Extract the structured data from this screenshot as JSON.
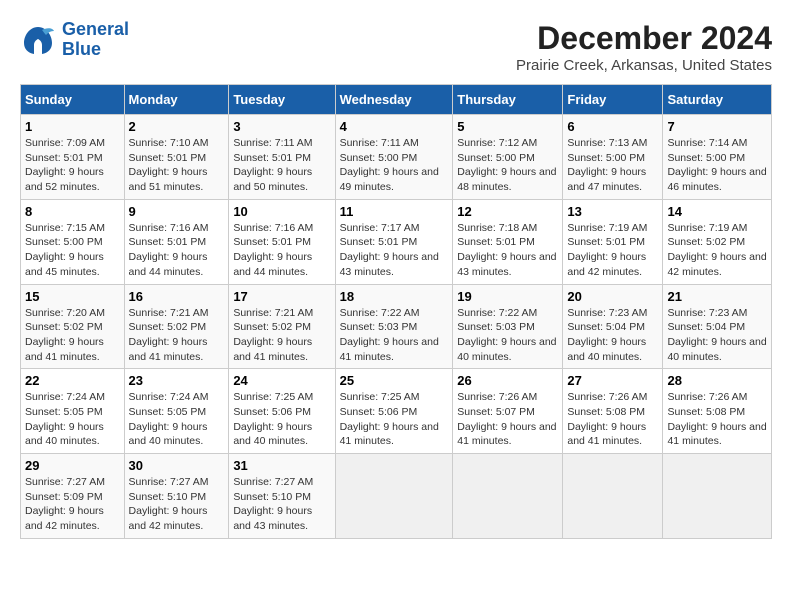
{
  "logo": {
    "line1": "General",
    "line2": "Blue"
  },
  "title": "December 2024",
  "subtitle": "Prairie Creek, Arkansas, United States",
  "days_of_week": [
    "Sunday",
    "Monday",
    "Tuesday",
    "Wednesday",
    "Thursday",
    "Friday",
    "Saturday"
  ],
  "weeks": [
    [
      {
        "day": "1",
        "sunrise": "7:09 AM",
        "sunset": "5:01 PM",
        "daylight": "9 hours and 52 minutes."
      },
      {
        "day": "2",
        "sunrise": "7:10 AM",
        "sunset": "5:01 PM",
        "daylight": "9 hours and 51 minutes."
      },
      {
        "day": "3",
        "sunrise": "7:11 AM",
        "sunset": "5:01 PM",
        "daylight": "9 hours and 50 minutes."
      },
      {
        "day": "4",
        "sunrise": "7:11 AM",
        "sunset": "5:00 PM",
        "daylight": "9 hours and 49 minutes."
      },
      {
        "day": "5",
        "sunrise": "7:12 AM",
        "sunset": "5:00 PM",
        "daylight": "9 hours and 48 minutes."
      },
      {
        "day": "6",
        "sunrise": "7:13 AM",
        "sunset": "5:00 PM",
        "daylight": "9 hours and 47 minutes."
      },
      {
        "day": "7",
        "sunrise": "7:14 AM",
        "sunset": "5:00 PM",
        "daylight": "9 hours and 46 minutes."
      }
    ],
    [
      {
        "day": "8",
        "sunrise": "7:15 AM",
        "sunset": "5:00 PM",
        "daylight": "9 hours and 45 minutes."
      },
      {
        "day": "9",
        "sunrise": "7:16 AM",
        "sunset": "5:01 PM",
        "daylight": "9 hours and 44 minutes."
      },
      {
        "day": "10",
        "sunrise": "7:16 AM",
        "sunset": "5:01 PM",
        "daylight": "9 hours and 44 minutes."
      },
      {
        "day": "11",
        "sunrise": "7:17 AM",
        "sunset": "5:01 PM",
        "daylight": "9 hours and 43 minutes."
      },
      {
        "day": "12",
        "sunrise": "7:18 AM",
        "sunset": "5:01 PM",
        "daylight": "9 hours and 43 minutes."
      },
      {
        "day": "13",
        "sunrise": "7:19 AM",
        "sunset": "5:01 PM",
        "daylight": "9 hours and 42 minutes."
      },
      {
        "day": "14",
        "sunrise": "7:19 AM",
        "sunset": "5:02 PM",
        "daylight": "9 hours and 42 minutes."
      }
    ],
    [
      {
        "day": "15",
        "sunrise": "7:20 AM",
        "sunset": "5:02 PM",
        "daylight": "9 hours and 41 minutes."
      },
      {
        "day": "16",
        "sunrise": "7:21 AM",
        "sunset": "5:02 PM",
        "daylight": "9 hours and 41 minutes."
      },
      {
        "day": "17",
        "sunrise": "7:21 AM",
        "sunset": "5:02 PM",
        "daylight": "9 hours and 41 minutes."
      },
      {
        "day": "18",
        "sunrise": "7:22 AM",
        "sunset": "5:03 PM",
        "daylight": "9 hours and 41 minutes."
      },
      {
        "day": "19",
        "sunrise": "7:22 AM",
        "sunset": "5:03 PM",
        "daylight": "9 hours and 40 minutes."
      },
      {
        "day": "20",
        "sunrise": "7:23 AM",
        "sunset": "5:04 PM",
        "daylight": "9 hours and 40 minutes."
      },
      {
        "day": "21",
        "sunrise": "7:23 AM",
        "sunset": "5:04 PM",
        "daylight": "9 hours and 40 minutes."
      }
    ],
    [
      {
        "day": "22",
        "sunrise": "7:24 AM",
        "sunset": "5:05 PM",
        "daylight": "9 hours and 40 minutes."
      },
      {
        "day": "23",
        "sunrise": "7:24 AM",
        "sunset": "5:05 PM",
        "daylight": "9 hours and 40 minutes."
      },
      {
        "day": "24",
        "sunrise": "7:25 AM",
        "sunset": "5:06 PM",
        "daylight": "9 hours and 40 minutes."
      },
      {
        "day": "25",
        "sunrise": "7:25 AM",
        "sunset": "5:06 PM",
        "daylight": "9 hours and 41 minutes."
      },
      {
        "day": "26",
        "sunrise": "7:26 AM",
        "sunset": "5:07 PM",
        "daylight": "9 hours and 41 minutes."
      },
      {
        "day": "27",
        "sunrise": "7:26 AM",
        "sunset": "5:08 PM",
        "daylight": "9 hours and 41 minutes."
      },
      {
        "day": "28",
        "sunrise": "7:26 AM",
        "sunset": "5:08 PM",
        "daylight": "9 hours and 41 minutes."
      }
    ],
    [
      {
        "day": "29",
        "sunrise": "7:27 AM",
        "sunset": "5:09 PM",
        "daylight": "9 hours and 42 minutes."
      },
      {
        "day": "30",
        "sunrise": "7:27 AM",
        "sunset": "5:10 PM",
        "daylight": "9 hours and 42 minutes."
      },
      {
        "day": "31",
        "sunrise": "7:27 AM",
        "sunset": "5:10 PM",
        "daylight": "9 hours and 43 minutes."
      },
      null,
      null,
      null,
      null
    ]
  ]
}
